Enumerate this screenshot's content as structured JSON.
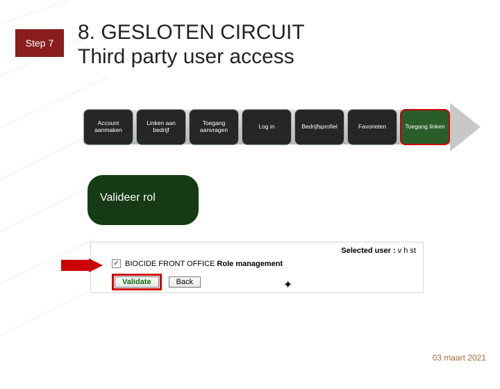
{
  "step_badge": "Step 7",
  "title_line1": "8. GESLOTEN CIRCUIT",
  "title_line2": "Third party user access",
  "progress": {
    "items": [
      {
        "label": "Account aanmaken",
        "variant": "dark"
      },
      {
        "label": "Linken aan bedrijf",
        "variant": "dark"
      },
      {
        "label": "Toegang aanvragen",
        "variant": "dark"
      },
      {
        "label": "Log in",
        "variant": "dark"
      },
      {
        "label": "Bedrijfsprofiel",
        "variant": "dark"
      },
      {
        "label": "Favorieten",
        "variant": "dark"
      },
      {
        "label": "Toegang linken",
        "variant": "current"
      }
    ]
  },
  "bubble_text": "Valideer rol",
  "validate_panel": {
    "selected_label": "Selected user :",
    "selected_value": "v h st",
    "role_text_prefix": "BIOCIDE FRONT OFFICE",
    "role_text_suffix": "Role management",
    "checked": true,
    "validate_btn": "Validate",
    "back_btn": "Back"
  },
  "date": "03 maart 2021",
  "colors": {
    "badge": "#8a1d1d",
    "accent_green": "#2b5d2b",
    "highlight_red": "#c00"
  }
}
